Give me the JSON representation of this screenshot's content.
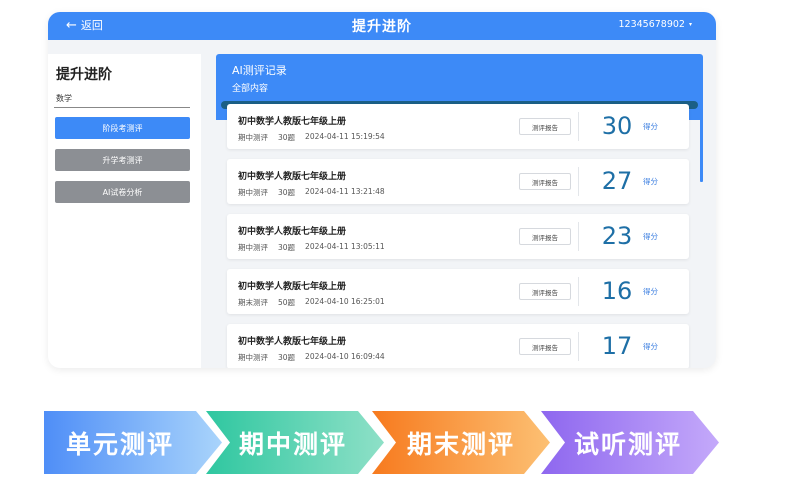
{
  "header": {
    "back_label": "返回",
    "title": "提升进阶",
    "account": "12345678902",
    "account_caret": "▾"
  },
  "sidebar": {
    "title": "提升进阶",
    "subject": "数学",
    "items": [
      {
        "label": "阶段考测评",
        "active": true
      },
      {
        "label": "升学考测评",
        "active": false
      },
      {
        "label": "AI试卷分析",
        "active": false
      }
    ]
  },
  "records_panel": {
    "title": "AI测评记录",
    "filter": "全部内容",
    "report_label": "测评报告",
    "score_unit": "得分",
    "items": [
      {
        "name": "初中数学人教版七年级上册",
        "type": "期中测评",
        "count": "30题",
        "time": "2024-04-11 15:19:54",
        "score": "30"
      },
      {
        "name": "初中数学人教版七年级上册",
        "type": "期中测评",
        "count": "30题",
        "time": "2024-04-11 13:21:48",
        "score": "27"
      },
      {
        "name": "初中数学人教版七年级上册",
        "type": "期中测评",
        "count": "30题",
        "time": "2024-04-11 13:05:11",
        "score": "23"
      },
      {
        "name": "初中数学人教版七年级上册",
        "type": "期末测评",
        "count": "50题",
        "time": "2024-04-10 16:25:01",
        "score": "16"
      },
      {
        "name": "初中数学人教版七年级上册",
        "type": "期中测评",
        "count": "30题",
        "time": "2024-04-10 16:09:44",
        "score": "17"
      }
    ]
  },
  "banners": [
    {
      "label": "单元测评",
      "color_start": "#4f8ef7",
      "color_end": "#a9d4fb"
    },
    {
      "label": "期中测评",
      "color_start": "#2fc7a0",
      "color_end": "#8ee0c7"
    },
    {
      "label": "期末测评",
      "color_start": "#f77a1e",
      "color_end": "#fcc073"
    },
    {
      "label": "试听测评",
      "color_start": "#8e67ef",
      "color_end": "#c4a9fa"
    }
  ],
  "colors": {
    "primary": "#3d8af7",
    "score_text": "#1e6fa6",
    "inactive_button": "#8c8f94"
  }
}
